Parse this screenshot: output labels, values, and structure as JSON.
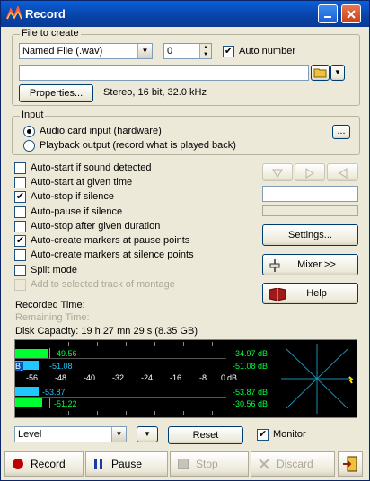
{
  "window": {
    "title": "Record"
  },
  "file_group": {
    "label": "File to create",
    "file_type": "Named File (.wav)",
    "number_value": "0",
    "auto_number_label": "Auto number",
    "auto_number_checked": true,
    "filename_value": "",
    "properties_label": "Properties...",
    "format_info": "Stereo, 16 bit, 32.0 kHz"
  },
  "input_group": {
    "label": "Input",
    "options": [
      {
        "label": "Audio card input (hardware)",
        "selected": true
      },
      {
        "label": "Playback output (record what is played back)",
        "selected": false
      }
    ],
    "more_label": "..."
  },
  "options": [
    {
      "label": "Auto-start if sound detected",
      "checked": false,
      "enabled": true
    },
    {
      "label": "Auto-start at given time",
      "checked": false,
      "enabled": true
    },
    {
      "label": "Auto-stop if silence",
      "checked": true,
      "enabled": true
    },
    {
      "label": "Auto-pause if silence",
      "checked": false,
      "enabled": true
    },
    {
      "label": "Auto-stop after given duration",
      "checked": false,
      "enabled": true
    },
    {
      "label": "Auto-create markers at pause points",
      "checked": true,
      "enabled": true
    },
    {
      "label": "Auto-create markers at silence points",
      "checked": false,
      "enabled": true
    },
    {
      "label": "Split mode",
      "checked": false,
      "enabled": true
    },
    {
      "label": "Add to selected track of montage",
      "checked": false,
      "enabled": false
    }
  ],
  "side": {
    "settings_label": "Settings...",
    "mixer_label": "Mixer >>",
    "help_label": "Help"
  },
  "status": {
    "recorded_time_label": "Recorded Time:",
    "remaining_time_label": "Remaining Time:",
    "disk_capacity": "Disk Capacity: 19 h 27 mn 29 s (8.35 GB)"
  },
  "meter": {
    "top_left_value": "-49.56",
    "top_mid_value": "-51.08",
    "top_right_peak": "-34.97 dB",
    "top_right_rms": "-51.08 dB",
    "scale": [
      "-56",
      "-48",
      "-40",
      "-32",
      "-24",
      "-16",
      "-8",
      "0"
    ],
    "scale_unit": "dB",
    "bot_left_value": "-53.87",
    "bot_mid_value": "-51.22",
    "bot_right_rms": "-53.87 dB",
    "bot_right_peak": "-30.56 dB",
    "left_marker": "B]"
  },
  "controls": {
    "view_select": "Level",
    "reset_label": "Reset",
    "monitor_label": "Monitor",
    "monitor_checked": true
  },
  "bottom": {
    "record_label": "Record",
    "pause_label": "Pause",
    "stop_label": "Stop",
    "discard_label": "Discard"
  },
  "colors": {
    "accent": "#0a5fd8",
    "meter_green": "#00ff30",
    "meter_cyan": "#20c8ff",
    "meter_text": "#00ff40",
    "record_red": "#c00000"
  }
}
